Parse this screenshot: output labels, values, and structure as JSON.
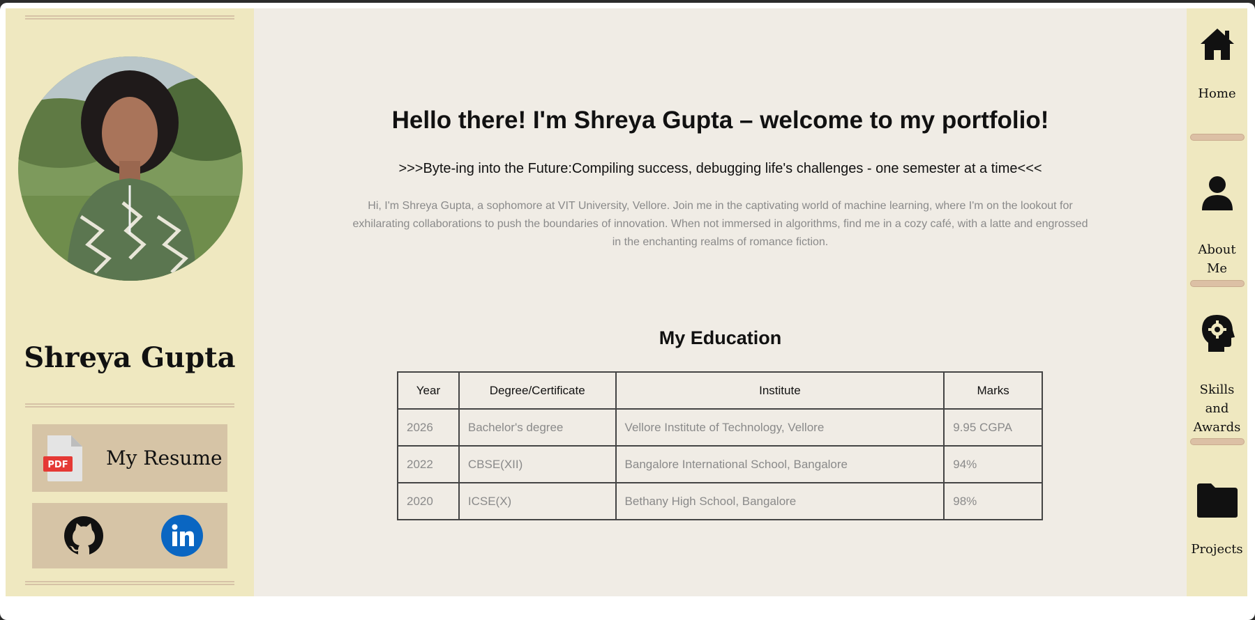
{
  "profile": {
    "name": "Shreya Gupta",
    "resume_label": "My Resume",
    "pdf_badge": "PDF"
  },
  "hero": {
    "title": "Hello there! I'm Shreya Gupta – welcome to my portfolio!",
    "tagline": ">>>Byte-ing into the Future:Compiling success, debugging life's challenges - one semester at a time<<<",
    "intro": "Hi, I'm Shreya Gupta, a sophomore at VIT University, Vellore. Join me in the captivating world of machine learning, where I'm on the lookout for exhilarating collaborations to push the boundaries of innovation. When not immersed in algorithms, find me in a cozy café, with a latte and engrossed in the enchanting realms of romance fiction."
  },
  "education": {
    "title": "My Education",
    "headers": [
      "Year",
      "Degree/Certificate",
      "Institute",
      "Marks"
    ],
    "rows": [
      [
        "2026",
        "Bachelor's degree",
        "Vellore Institute of Technology, Vellore",
        "9.95 CGPA"
      ],
      [
        "2022",
        "CBSE(XII)",
        "Bangalore International School, Bangalore",
        "94%"
      ],
      [
        "2020",
        "ICSE(X)",
        "Bethany High School, Bangalore",
        "98%"
      ]
    ]
  },
  "nav": {
    "items": [
      {
        "label": "Home",
        "icon": "home-icon"
      },
      {
        "label": "About Me",
        "icon": "user-icon"
      },
      {
        "label": "Skills and Awards",
        "icon": "head-gear-icon"
      },
      {
        "label": "Projects",
        "icon": "folder-icon"
      }
    ]
  },
  "colors": {
    "sidebar_bg": "#efe8c0",
    "main_bg": "#f0ece5",
    "card_bg": "#d6c4a6",
    "divider": "#dcc0a5",
    "linkedin_blue": "#0a66c2",
    "pdf_red": "#e53935"
  }
}
